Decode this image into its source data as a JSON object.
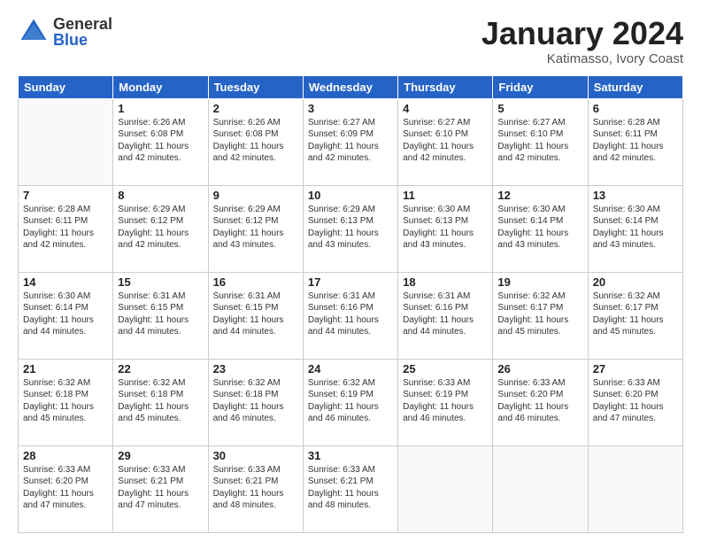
{
  "header": {
    "logo_general": "General",
    "logo_blue": "Blue",
    "month_title": "January 2024",
    "location": "Katimasso, Ivory Coast"
  },
  "weekdays": [
    "Sunday",
    "Monday",
    "Tuesday",
    "Wednesday",
    "Thursday",
    "Friday",
    "Saturday"
  ],
  "weeks": [
    [
      {
        "day": "",
        "sunrise": "",
        "sunset": "",
        "daylight": ""
      },
      {
        "day": "1",
        "sunrise": "Sunrise: 6:26 AM",
        "sunset": "Sunset: 6:08 PM",
        "daylight": "Daylight: 11 hours and 42 minutes."
      },
      {
        "day": "2",
        "sunrise": "Sunrise: 6:26 AM",
        "sunset": "Sunset: 6:08 PM",
        "daylight": "Daylight: 11 hours and 42 minutes."
      },
      {
        "day": "3",
        "sunrise": "Sunrise: 6:27 AM",
        "sunset": "Sunset: 6:09 PM",
        "daylight": "Daylight: 11 hours and 42 minutes."
      },
      {
        "day": "4",
        "sunrise": "Sunrise: 6:27 AM",
        "sunset": "Sunset: 6:10 PM",
        "daylight": "Daylight: 11 hours and 42 minutes."
      },
      {
        "day": "5",
        "sunrise": "Sunrise: 6:27 AM",
        "sunset": "Sunset: 6:10 PM",
        "daylight": "Daylight: 11 hours and 42 minutes."
      },
      {
        "day": "6",
        "sunrise": "Sunrise: 6:28 AM",
        "sunset": "Sunset: 6:11 PM",
        "daylight": "Daylight: 11 hours and 42 minutes."
      }
    ],
    [
      {
        "day": "7",
        "sunrise": "Sunrise: 6:28 AM",
        "sunset": "Sunset: 6:11 PM",
        "daylight": "Daylight: 11 hours and 42 minutes."
      },
      {
        "day": "8",
        "sunrise": "Sunrise: 6:29 AM",
        "sunset": "Sunset: 6:12 PM",
        "daylight": "Daylight: 11 hours and 42 minutes."
      },
      {
        "day": "9",
        "sunrise": "Sunrise: 6:29 AM",
        "sunset": "Sunset: 6:12 PM",
        "daylight": "Daylight: 11 hours and 43 minutes."
      },
      {
        "day": "10",
        "sunrise": "Sunrise: 6:29 AM",
        "sunset": "Sunset: 6:13 PM",
        "daylight": "Daylight: 11 hours and 43 minutes."
      },
      {
        "day": "11",
        "sunrise": "Sunrise: 6:30 AM",
        "sunset": "Sunset: 6:13 PM",
        "daylight": "Daylight: 11 hours and 43 minutes."
      },
      {
        "day": "12",
        "sunrise": "Sunrise: 6:30 AM",
        "sunset": "Sunset: 6:14 PM",
        "daylight": "Daylight: 11 hours and 43 minutes."
      },
      {
        "day": "13",
        "sunrise": "Sunrise: 6:30 AM",
        "sunset": "Sunset: 6:14 PM",
        "daylight": "Daylight: 11 hours and 43 minutes."
      }
    ],
    [
      {
        "day": "14",
        "sunrise": "Sunrise: 6:30 AM",
        "sunset": "Sunset: 6:14 PM",
        "daylight": "Daylight: 11 hours and 44 minutes."
      },
      {
        "day": "15",
        "sunrise": "Sunrise: 6:31 AM",
        "sunset": "Sunset: 6:15 PM",
        "daylight": "Daylight: 11 hours and 44 minutes."
      },
      {
        "day": "16",
        "sunrise": "Sunrise: 6:31 AM",
        "sunset": "Sunset: 6:15 PM",
        "daylight": "Daylight: 11 hours and 44 minutes."
      },
      {
        "day": "17",
        "sunrise": "Sunrise: 6:31 AM",
        "sunset": "Sunset: 6:16 PM",
        "daylight": "Daylight: 11 hours and 44 minutes."
      },
      {
        "day": "18",
        "sunrise": "Sunrise: 6:31 AM",
        "sunset": "Sunset: 6:16 PM",
        "daylight": "Daylight: 11 hours and 44 minutes."
      },
      {
        "day": "19",
        "sunrise": "Sunrise: 6:32 AM",
        "sunset": "Sunset: 6:17 PM",
        "daylight": "Daylight: 11 hours and 45 minutes."
      },
      {
        "day": "20",
        "sunrise": "Sunrise: 6:32 AM",
        "sunset": "Sunset: 6:17 PM",
        "daylight": "Daylight: 11 hours and 45 minutes."
      }
    ],
    [
      {
        "day": "21",
        "sunrise": "Sunrise: 6:32 AM",
        "sunset": "Sunset: 6:18 PM",
        "daylight": "Daylight: 11 hours and 45 minutes."
      },
      {
        "day": "22",
        "sunrise": "Sunrise: 6:32 AM",
        "sunset": "Sunset: 6:18 PM",
        "daylight": "Daylight: 11 hours and 45 minutes."
      },
      {
        "day": "23",
        "sunrise": "Sunrise: 6:32 AM",
        "sunset": "Sunset: 6:18 PM",
        "daylight": "Daylight: 11 hours and 46 minutes."
      },
      {
        "day": "24",
        "sunrise": "Sunrise: 6:32 AM",
        "sunset": "Sunset: 6:19 PM",
        "daylight": "Daylight: 11 hours and 46 minutes."
      },
      {
        "day": "25",
        "sunrise": "Sunrise: 6:33 AM",
        "sunset": "Sunset: 6:19 PM",
        "daylight": "Daylight: 11 hours and 46 minutes."
      },
      {
        "day": "26",
        "sunrise": "Sunrise: 6:33 AM",
        "sunset": "Sunset: 6:20 PM",
        "daylight": "Daylight: 11 hours and 46 minutes."
      },
      {
        "day": "27",
        "sunrise": "Sunrise: 6:33 AM",
        "sunset": "Sunset: 6:20 PM",
        "daylight": "Daylight: 11 hours and 47 minutes."
      }
    ],
    [
      {
        "day": "28",
        "sunrise": "Sunrise: 6:33 AM",
        "sunset": "Sunset: 6:20 PM",
        "daylight": "Daylight: 11 hours and 47 minutes."
      },
      {
        "day": "29",
        "sunrise": "Sunrise: 6:33 AM",
        "sunset": "Sunset: 6:21 PM",
        "daylight": "Daylight: 11 hours and 47 minutes."
      },
      {
        "day": "30",
        "sunrise": "Sunrise: 6:33 AM",
        "sunset": "Sunset: 6:21 PM",
        "daylight": "Daylight: 11 hours and 48 minutes."
      },
      {
        "day": "31",
        "sunrise": "Sunrise: 6:33 AM",
        "sunset": "Sunset: 6:21 PM",
        "daylight": "Daylight: 11 hours and 48 minutes."
      },
      {
        "day": "",
        "sunrise": "",
        "sunset": "",
        "daylight": ""
      },
      {
        "day": "",
        "sunrise": "",
        "sunset": "",
        "daylight": ""
      },
      {
        "day": "",
        "sunrise": "",
        "sunset": "",
        "daylight": ""
      }
    ]
  ]
}
